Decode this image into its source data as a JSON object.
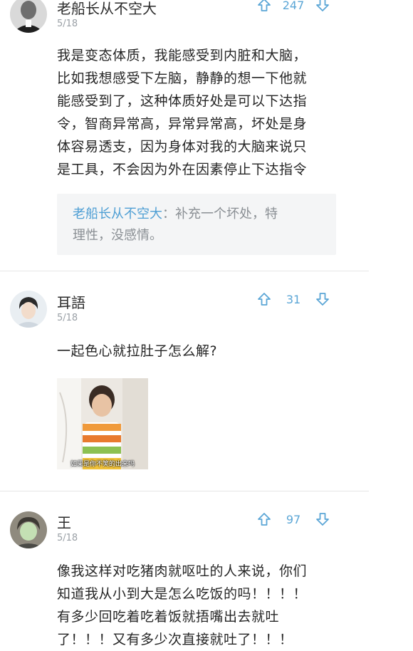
{
  "comments": [
    {
      "username": "老船长从不空大",
      "date": "5/18",
      "votes": "247",
      "lines": [
        "我是变态体质，我能感受到内脏和大脑，",
        "比如我想感受下左脑，静静的想一下他就",
        "能感受到了，这种体质好处是可以下达指",
        "令，智商异常高，异常异常高，坏处是身",
        "体容易透支，因为身体对我的大脑来说只",
        "是工具，不会因为外在因素停止下达指令"
      ],
      "reply": {
        "author": "老船长从不空大",
        "separator": "：",
        "line1": "补充一个坏处，特",
        "line2": "理性，没感情。"
      }
    },
    {
      "username": "耳語",
      "date": "5/18",
      "votes": "31",
      "lines": [
        "一起色心就拉肚子怎么解?"
      ],
      "image_caption": "如果是你不笑的出来吗"
    },
    {
      "username": "王",
      "date": "5/18",
      "votes": "97",
      "lines": [
        "像我这样对吃猪肉就呕吐的人来说，你们",
        "知道我从小到大是怎么吃饭的吗！！！！",
        "有多少回吃着吃着饭就捂嘴出去就吐",
        "了！！！又有多少次直接就吐了！！！"
      ]
    }
  ],
  "icons": {
    "upvote": "arrow-up-outline-icon",
    "downvote": "arrow-down-outline-icon"
  },
  "colors": {
    "accent": "#5ba6d6",
    "reply_name": "#4f9fd4",
    "reply_bg": "#f4f5f6",
    "date": "#9aa0a6"
  }
}
